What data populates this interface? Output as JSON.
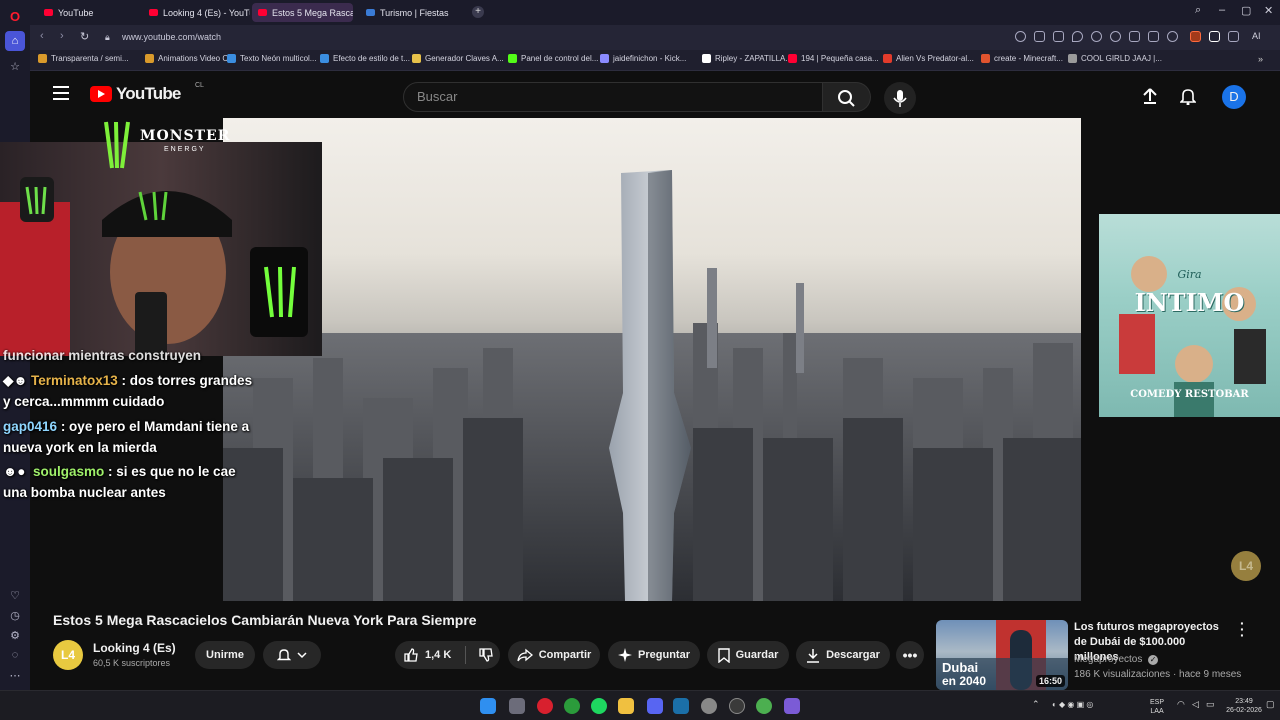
{
  "browser": {
    "tabs": [
      {
        "label": "YouTube",
        "favicon_color": "#ff0033"
      },
      {
        "label": "Looking 4 (Es) - YouTube",
        "favicon_color": "#ff0033"
      },
      {
        "label": "Estos 5 Mega Rascac",
        "favicon_color": "#ff0033"
      },
      {
        "label": "Turismo | Fiestas",
        "favicon_color": "#3a7bd5"
      }
    ],
    "new_tab_icon": "plus-icon",
    "url": "www.youtube.com/watch",
    "window_controls": [
      "search-icon",
      "minimize-icon",
      "maximize-icon",
      "close-icon"
    ],
    "extension_icons": [
      "lens-icon",
      "camera-icon",
      "snapshot-icon",
      "shield-icon",
      "play-icon",
      "heart-icon",
      "download-icon",
      "lock-icon",
      "person-icon",
      "extension-red-icon",
      "translate-icon",
      "cube-icon"
    ],
    "ai_label": "AI",
    "bookmarks": [
      {
        "label": "Transparenta / semi...",
        "color": "#d99a2b"
      },
      {
        "label": "Animations Video C...",
        "color": "#d99a2b"
      },
      {
        "label": "Texto Neón multicol...",
        "color": "#3b8ee0"
      },
      {
        "label": "Efecto de estilo de t...",
        "color": "#3b8ee0"
      },
      {
        "label": "Generador Claves A...",
        "color": "#e6c14a"
      },
      {
        "label": "Panel de control del...",
        "color": "#53fc18"
      },
      {
        "label": "jaidefinichon - Kick...",
        "color": "#8a8aff"
      },
      {
        "label": "Ripley - ZAPATILLA...",
        "color": "#ffffff"
      },
      {
        "label": "194 | Pequeña casa...",
        "color": "#ff0033"
      },
      {
        "label": "Alien Vs Predator-al...",
        "color": "#e23b2b"
      },
      {
        "label": "create - Minecraft...",
        "color": "#e0532e"
      },
      {
        "label": "COOL GIRLD JAAJ |...",
        "color": "#9a9a9a"
      }
    ],
    "sidebar_icons": [
      "opera-icon",
      "home-icon",
      "pin-icon",
      "heart-icon",
      "history-icon",
      "settings-icon",
      "bulb-icon",
      "more-icon"
    ]
  },
  "youtube": {
    "logo_text": "YouTube",
    "country_code": "CL",
    "search_placeholder": "Buscar",
    "avatar_letter": "D",
    "video": {
      "title": "Estos 5 Mega Rascacielos Cambiarán Nueva York Para Siempre",
      "overlay_chat": [
        {
          "user": "",
          "message": "funcionar mientras construyen",
          "user_color": "#ffffff"
        },
        {
          "user": "Terminatox13",
          "message": ": dos torres grandes",
          "user_color": "#e6b34a"
        },
        {
          "user": "",
          "message": "y cerca...mmmm cuidado",
          "user_color": "#ffffff"
        },
        {
          "user": "gap0416",
          "message": ": oye pero el Mamdani tiene a",
          "user_color": "#8fd6ff"
        },
        {
          "user": "",
          "message": "nueva york en la mierda",
          "user_color": "#ffffff"
        },
        {
          "user": "soulgasmo",
          "message": ": si es que no le cae",
          "user_color": "#9ff06a"
        },
        {
          "user": "",
          "message": "una bomba nuclear antes",
          "user_color": "#ffffff"
        }
      ],
      "overlay_brand": "MONSTER",
      "overlay_brand_sub": "ENERGY",
      "ad_poster": {
        "title": "INTIMO",
        "subtitle": "Gira",
        "venue": "COMEDY RESTOBAR"
      },
      "watermark": "L4"
    },
    "channel": {
      "name": "Looking 4 (Es)",
      "subscribers": "60,5 K suscriptores",
      "avatar_text": "L4"
    },
    "actions": {
      "join": "Unirme",
      "likes": "1,4 K",
      "share": "Compartir",
      "ask": "Preguntar",
      "save": "Guardar",
      "download": "Descargar"
    },
    "recommended": {
      "title": "Los futuros megaproyectos de Dubái de $100.000 millones",
      "channel": "Megaproyectos",
      "meta": "186 K visualizaciones · hace 9 meses",
      "duration": "16:50",
      "thumb_text_1": "Dubai",
      "thumb_text_2": "en 2040"
    }
  },
  "taskbar": {
    "apps": [
      "windows-icon",
      "taskview-icon",
      "opera-icon",
      "xbox-icon",
      "spotify-icon",
      "explorer-icon",
      "discord-icon",
      "steam-icon",
      "chrome-icon",
      "obs-icon",
      "xbox-green-icon",
      "vpn-icon"
    ],
    "lang_1": "ESP",
    "lang_2": "LAA",
    "time": "23:49",
    "date": "26-02-2026"
  }
}
